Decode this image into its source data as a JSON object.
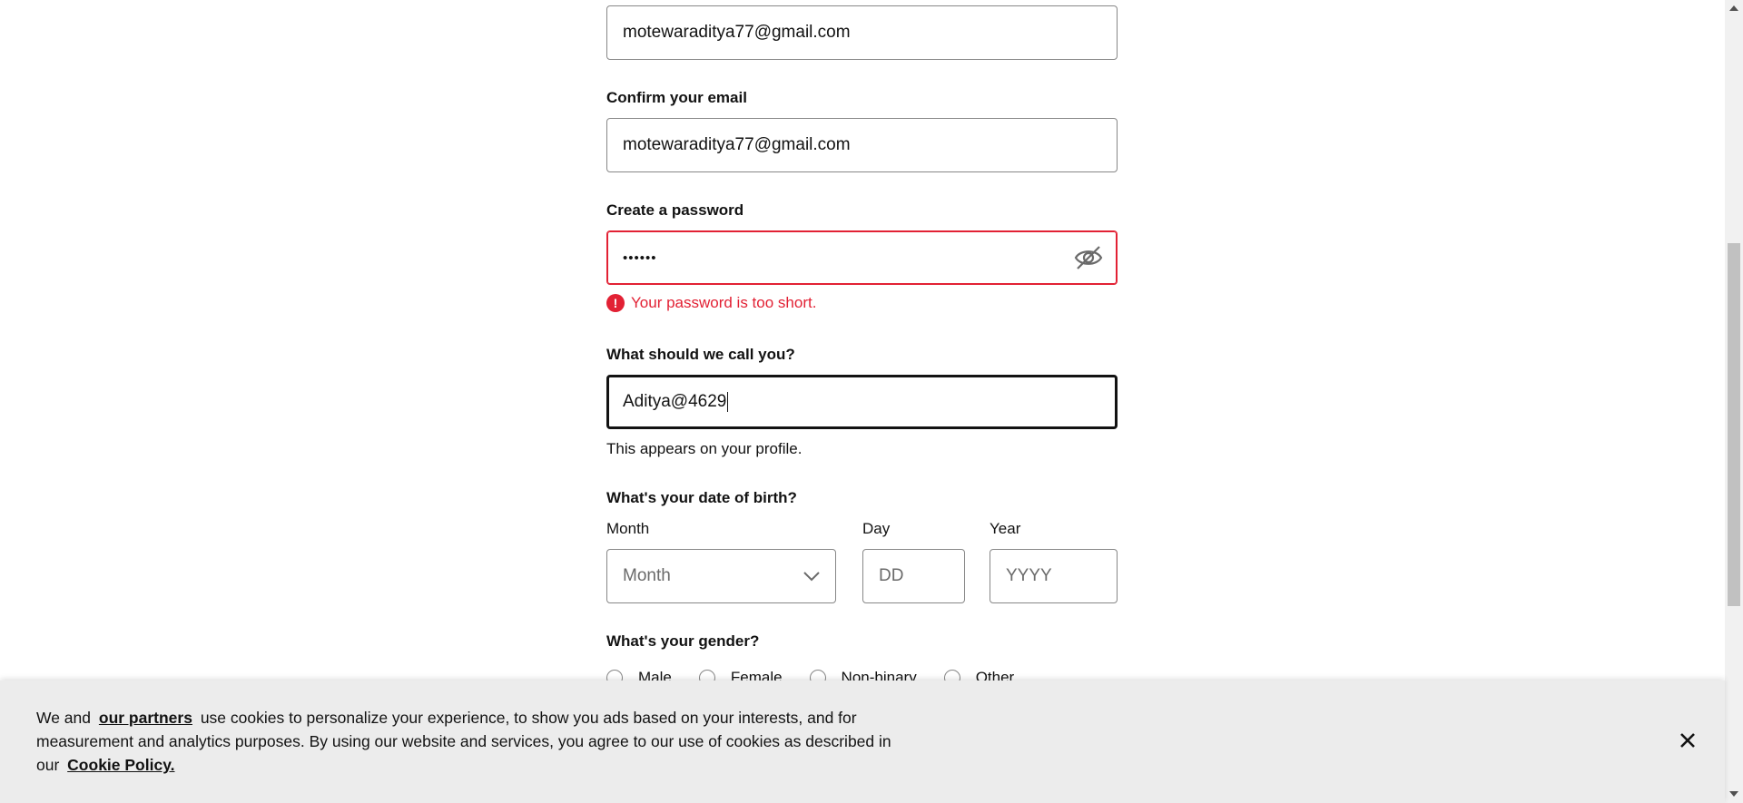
{
  "form": {
    "email_value": "motewaraditya77@gmail.com",
    "confirm_email_label": "Confirm your email",
    "confirm_email_value": "motewaraditya77@gmail.com",
    "password_label": "Create a password",
    "password_value": "••••••",
    "password_error": "Your password is too short.",
    "name_label": "What should we call you?",
    "name_value": "Aditya@4629",
    "name_helper": "This appears on your profile.",
    "dob_label": "What's your date of birth?",
    "month_label": "Month",
    "month_value": "Month",
    "day_label": "Day",
    "day_placeholder": "DD",
    "year_label": "Year",
    "year_placeholder": "YYYY",
    "gender_label": "What's your gender?",
    "gender_options": [
      "Male",
      "Female",
      "Non-binary",
      "Other"
    ]
  },
  "cookie_banner": {
    "text_before": "We and",
    "partners_link": "our partners",
    "text_middle": "use cookies to personalize your experience, to show you ads based on your interests, and for measurement and analytics purposes. By using our website and services, you agree to our use of cookies as described in our",
    "policy_link": "Cookie Policy.",
    "close_icon": "close-icon"
  },
  "colors": {
    "error": "#e22134",
    "text": "#121212",
    "border": "#878787",
    "banner_bg": "#ececec"
  }
}
